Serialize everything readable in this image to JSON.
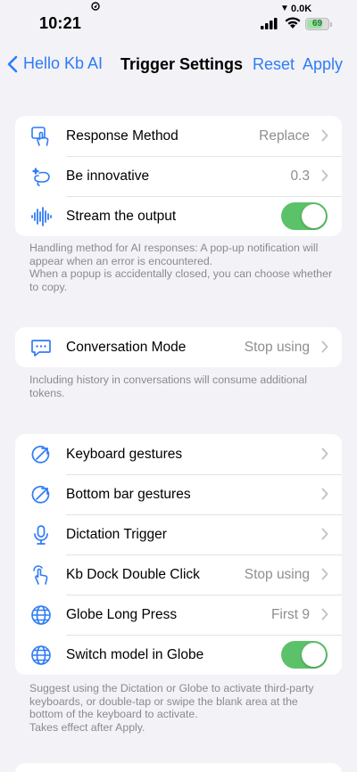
{
  "status_bar": {
    "time": "10:21",
    "network_speed": "0.0K",
    "battery": "69"
  },
  "nav": {
    "back_label": "Hello Kb AI",
    "title": "Trigger Settings",
    "reset_label": "Reset",
    "apply_label": "Apply"
  },
  "colors": {
    "accent": "#2f7cf6",
    "toggle_on": "#5cc269",
    "background": "#f2f2f7"
  },
  "group1": {
    "rows": [
      {
        "icon": "tap-hand-icon",
        "label": "Response Method",
        "value": "Replace"
      },
      {
        "icon": "sparkle-lasso-icon",
        "label": "Be innovative",
        "value": "0.3"
      },
      {
        "icon": "waveform-icon",
        "label": "Stream the output",
        "toggle": true
      }
    ],
    "footnote": "Handling method for AI responses: A pop-up notification will appear when an error is encountered.\nWhen a popup is accidentally closed, you can choose whether to copy."
  },
  "group2": {
    "rows": [
      {
        "icon": "chat-bubble-icon",
        "label": "Conversation Mode",
        "value": "Stop using"
      }
    ],
    "footnote": "Including history in conversations will consume additional tokens."
  },
  "group3": {
    "rows": [
      {
        "icon": "gesture-icon",
        "label": "Keyboard gestures",
        "value": ""
      },
      {
        "icon": "gesture-icon",
        "label": "Bottom bar gestures",
        "value": ""
      },
      {
        "icon": "microphone-icon",
        "label": "Dictation Trigger",
        "value": ""
      },
      {
        "icon": "double-tap-icon",
        "label": "Kb Dock Double Click",
        "value": "Stop using"
      },
      {
        "icon": "globe-icon",
        "label": "Globe Long Press",
        "value": "First 9"
      },
      {
        "icon": "globe-icon",
        "label": "Switch model in Globe",
        "toggle": true
      }
    ],
    "footnote": "Suggest using the Dictation or Globe to activate third-party keyboards, or double-tap or swipe the blank area at the bottom of the keyboard to activate.\nTakes effect after Apply."
  }
}
